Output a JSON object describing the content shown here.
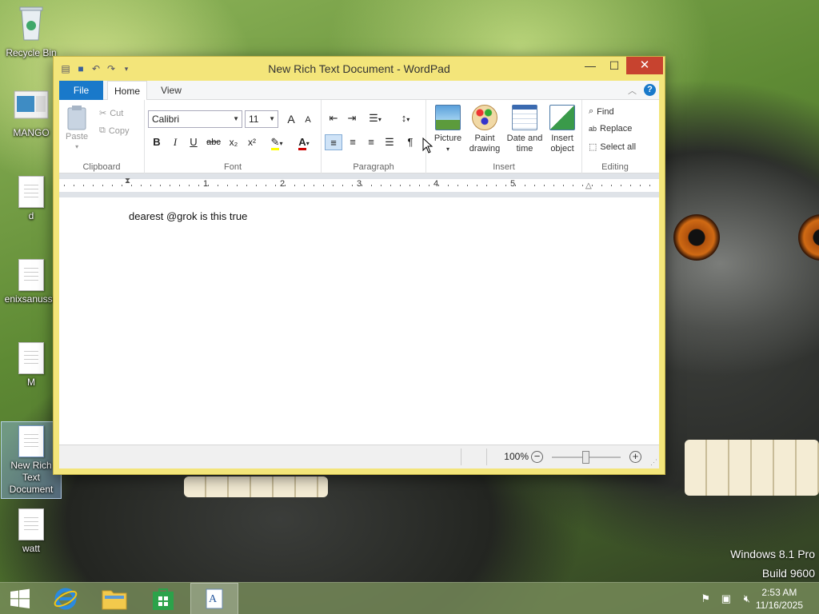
{
  "desktop": {
    "icons": [
      {
        "label": "Recycle Bin",
        "icon": "recycle-bin-icon"
      },
      {
        "label": "MANGO",
        "icon": "app-icon"
      },
      {
        "label": "d",
        "icon": "document-icon"
      },
      {
        "label": "enixsanusso",
        "icon": "document-icon"
      },
      {
        "label": "M",
        "icon": "document-icon"
      },
      {
        "label": "New Rich Text Document",
        "icon": "rtf-document-icon"
      },
      {
        "label": "watt",
        "icon": "document-icon"
      }
    ],
    "os_name": "Windows 8.1 Pro",
    "os_build": "Build 9600"
  },
  "window": {
    "title": "New Rich Text Document - WordPad",
    "controls": {
      "minimize": "—",
      "maximize": "☐",
      "close": "✕"
    },
    "tabs": [
      "File",
      "Home",
      "View"
    ],
    "ribbon": {
      "clipboard": {
        "label": "Clipboard",
        "paste": "Paste",
        "cut": "Cut",
        "copy": "Copy"
      },
      "font": {
        "label": "Font",
        "family": "Calibri",
        "size": "11",
        "bold": "B",
        "italic": "I",
        "underline": "U",
        "strike": "abc",
        "subscript": "x₂",
        "superscript": "x²",
        "grow": "A",
        "shrink": "A"
      },
      "paragraph": {
        "label": "Paragraph"
      },
      "insert": {
        "label": "Insert",
        "picture": "Picture",
        "paint": "Paint drawing",
        "paint_l1": "Paint",
        "paint_l2": "drawing",
        "datetime_l1": "Date and",
        "datetime_l2": "time",
        "object_l1": "Insert",
        "object_l2": "object"
      },
      "editing": {
        "label": "Editing",
        "find": "Find",
        "replace": "Replace",
        "select_all": "Select all"
      }
    },
    "ruler_numbers": [
      "1",
      "2",
      "3",
      "4",
      "5"
    ],
    "document_text": "dearest @grok is this true",
    "zoom": "100%",
    "zoom_level": 1.0
  },
  "taskbar": {
    "clock_time": "2:53 AM",
    "clock_date": "11/16/2025"
  },
  "colors": {
    "accent": "#1979ca",
    "window_frame": "#f3e57a",
    "close": "#c7432f"
  }
}
